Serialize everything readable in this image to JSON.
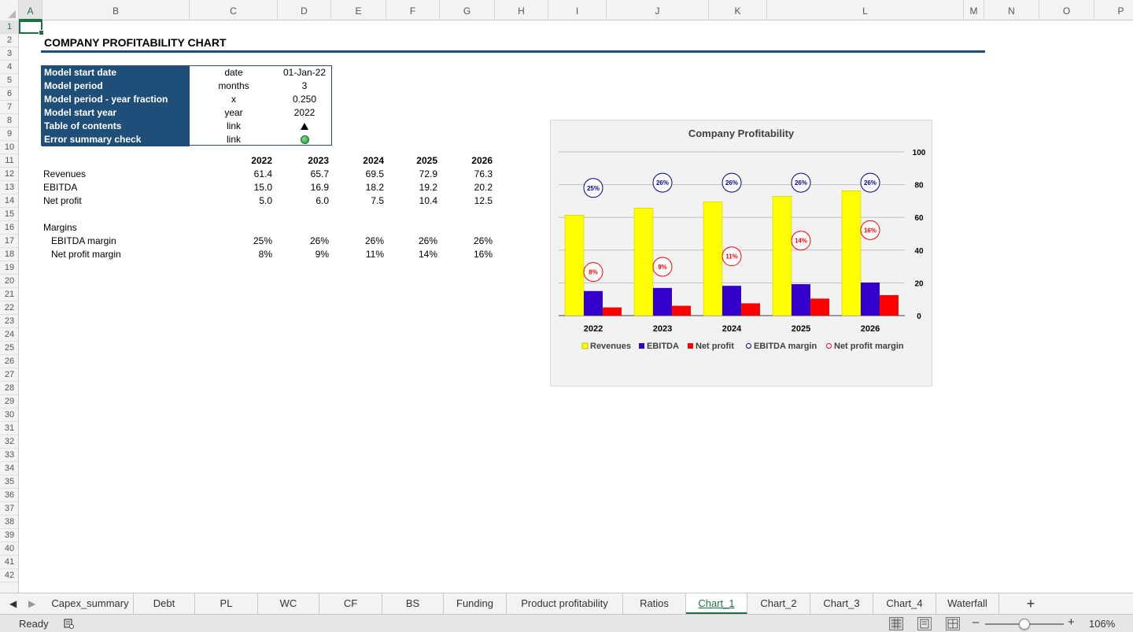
{
  "columns": [
    "A",
    "B",
    "C",
    "D",
    "E",
    "F",
    "G",
    "H",
    "I",
    "J",
    "K",
    "L",
    "M",
    "N",
    "O",
    "P"
  ],
  "rows": [
    "1",
    "2",
    "3",
    "4",
    "5",
    "6",
    "7",
    "8",
    "9",
    "10",
    "11",
    "12",
    "13",
    "14",
    "15",
    "16",
    "17",
    "18",
    "19",
    "20",
    "21",
    "22",
    "23",
    "24",
    "25",
    "26",
    "27",
    "28",
    "29",
    "30",
    "31",
    "32",
    "33",
    "34",
    "35",
    "36",
    "37",
    "38",
    "39",
    "40",
    "41",
    "42"
  ],
  "sheet": {
    "title": "COMPANY PROFITABILITY CHART",
    "inputs": [
      {
        "label": "Model start date",
        "unit": "date",
        "value": "01-Jan-22"
      },
      {
        "label": "Model period",
        "unit": "months",
        "value": "3"
      },
      {
        "label": "Model period - year fraction",
        "unit": "x",
        "value": "0.250"
      },
      {
        "label": "Model start year",
        "unit": "year",
        "value": "2022"
      },
      {
        "label": "Table of contents",
        "unit": "link",
        "value": ""
      },
      {
        "label": "Error summary check",
        "unit": "link",
        "value": ""
      }
    ],
    "years": [
      "2022",
      "2023",
      "2024",
      "2025",
      "2026"
    ],
    "rows": [
      {
        "label": "Revenues",
        "values": [
          "61.4",
          "65.7",
          "69.5",
          "72.9",
          "76.3"
        ]
      },
      {
        "label": "EBITDA",
        "values": [
          "15.0",
          "16.9",
          "18.2",
          "19.2",
          "20.2"
        ]
      },
      {
        "label": "Net profit",
        "values": [
          "5.0",
          "6.0",
          "7.5",
          "10.4",
          "12.5"
        ]
      }
    ],
    "margins_header": "Margins",
    "margins": [
      {
        "label": "EBITDA margin",
        "values": [
          "25%",
          "26%",
          "26%",
          "26%",
          "26%"
        ]
      },
      {
        "label": "Net profit margin",
        "values": [
          "8%",
          "9%",
          "11%",
          "14%",
          "16%"
        ]
      }
    ]
  },
  "chart_data": {
    "type": "bar",
    "title": "Company Profitability",
    "categories": [
      "2022",
      "2023",
      "2024",
      "2025",
      "2026"
    ],
    "series": [
      {
        "name": "Revenues",
        "type": "bar",
        "color": "#ffff00",
        "values": [
          61.4,
          65.7,
          69.5,
          72.9,
          76.3
        ]
      },
      {
        "name": "EBITDA",
        "type": "bar",
        "color": "#3300cc",
        "values": [
          15.0,
          16.9,
          18.2,
          19.2,
          20.2
        ]
      },
      {
        "name": "Net profit",
        "type": "bar",
        "color": "#ff0000",
        "values": [
          5.0,
          6.0,
          7.5,
          10.4,
          12.5
        ]
      },
      {
        "name": "EBITDA margin",
        "type": "scatter",
        "color": "#000099",
        "values": [
          0.25,
          0.26,
          0.26,
          0.26,
          0.26
        ],
        "labels": [
          "25%",
          "26%",
          "26%",
          "26%",
          "26%"
        ]
      },
      {
        "name": "Net profit margin",
        "type": "scatter",
        "color": "#ff0000",
        "values": [
          0.08,
          0.09,
          0.11,
          0.14,
          0.16
        ],
        "labels": [
          "8%",
          "9%",
          "11%",
          "14%",
          "16%"
        ]
      }
    ],
    "ylim": [
      0,
      100
    ],
    "yticks": [
      "0",
      "20",
      "40",
      "60",
      "80",
      "100"
    ],
    "y_axis_side": "right",
    "grid": true,
    "legend": "bottom"
  },
  "tabs": [
    "Capex_summary",
    "Debt",
    "PL",
    "WC",
    "CF",
    "BS",
    "Funding",
    "Product profitability",
    "Ratios",
    "Chart_1",
    "Chart_2",
    "Chart_3",
    "Chart_4",
    "Waterfall"
  ],
  "active_tab": "Chart_1",
  "icons": {
    "add_sheet": "plus-icon",
    "nav_prev": "triangle-left-icon",
    "nav_next": "triangle-right-icon"
  },
  "status": {
    "ready": "Ready",
    "zoom": "106%"
  }
}
